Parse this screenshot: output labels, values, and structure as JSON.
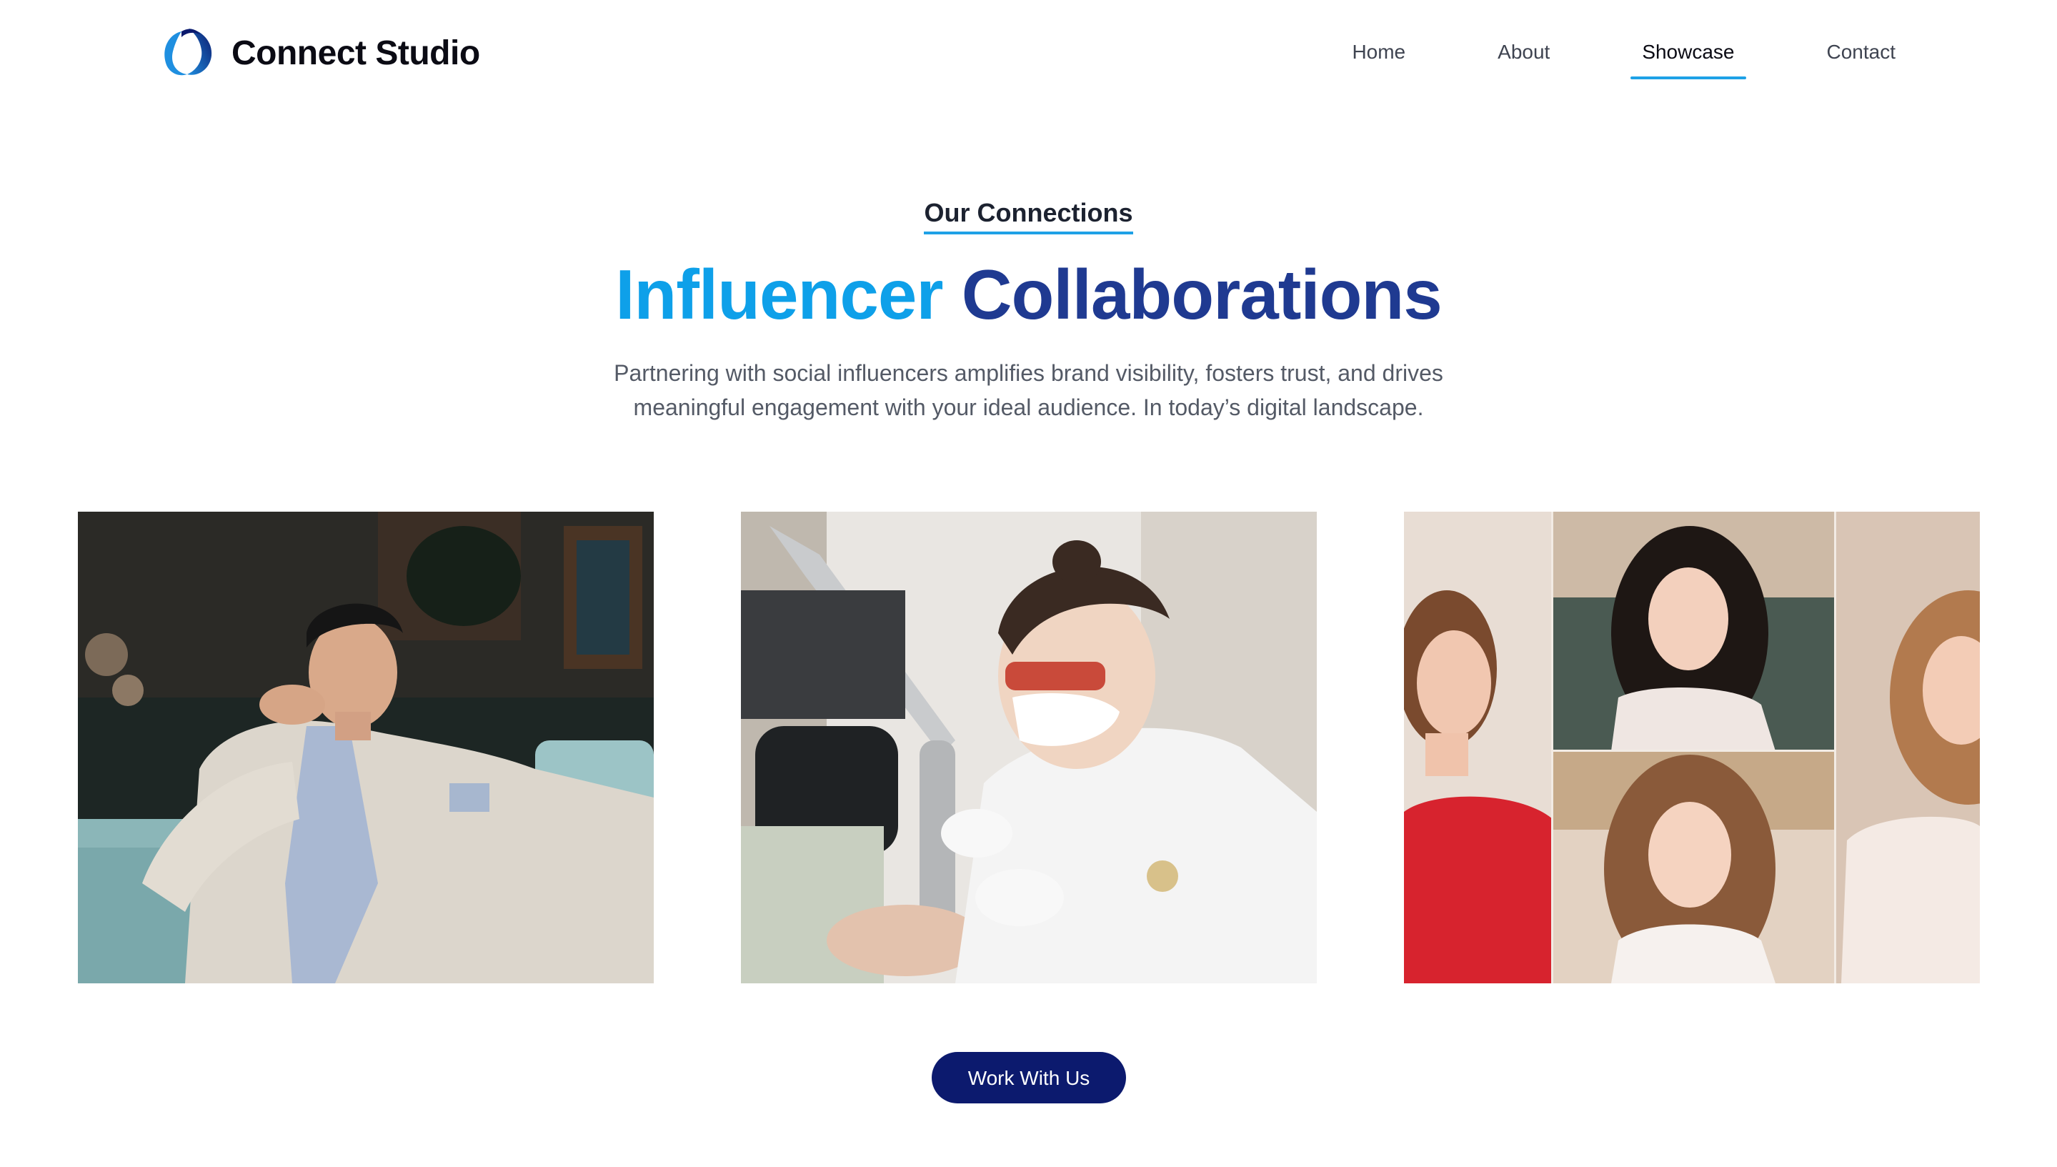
{
  "brand": {
    "name": "Connect Studio",
    "logo_icon": "ring-logo-icon"
  },
  "nav": {
    "items": [
      {
        "label": "Home"
      },
      {
        "label": "About"
      },
      {
        "label": "Showcase"
      },
      {
        "label": "Contact"
      }
    ],
    "active": "Showcase"
  },
  "intro": {
    "eyebrow": "Our Connections",
    "headline_accent": "Influencer",
    "headline_main": "Collaborations",
    "description": "Partnering with social influencers amplifies brand visibility, fosters trust, and drives meaningful engagement with your ideal audience. In today’s digital landscape."
  },
  "gallery": {
    "images": [
      {
        "subject": "man in light suit seated on sofa"
      },
      {
        "subject": "clinician performing facial laser treatment"
      },
      {
        "subject": "collage of three female influencers"
      }
    ]
  },
  "cta": {
    "label": "Work With Us"
  },
  "colors": {
    "accent": "#0ea0e9",
    "primary": "#1f3a91",
    "button": "#0c1a6e",
    "underline": "#1ea1e6"
  }
}
